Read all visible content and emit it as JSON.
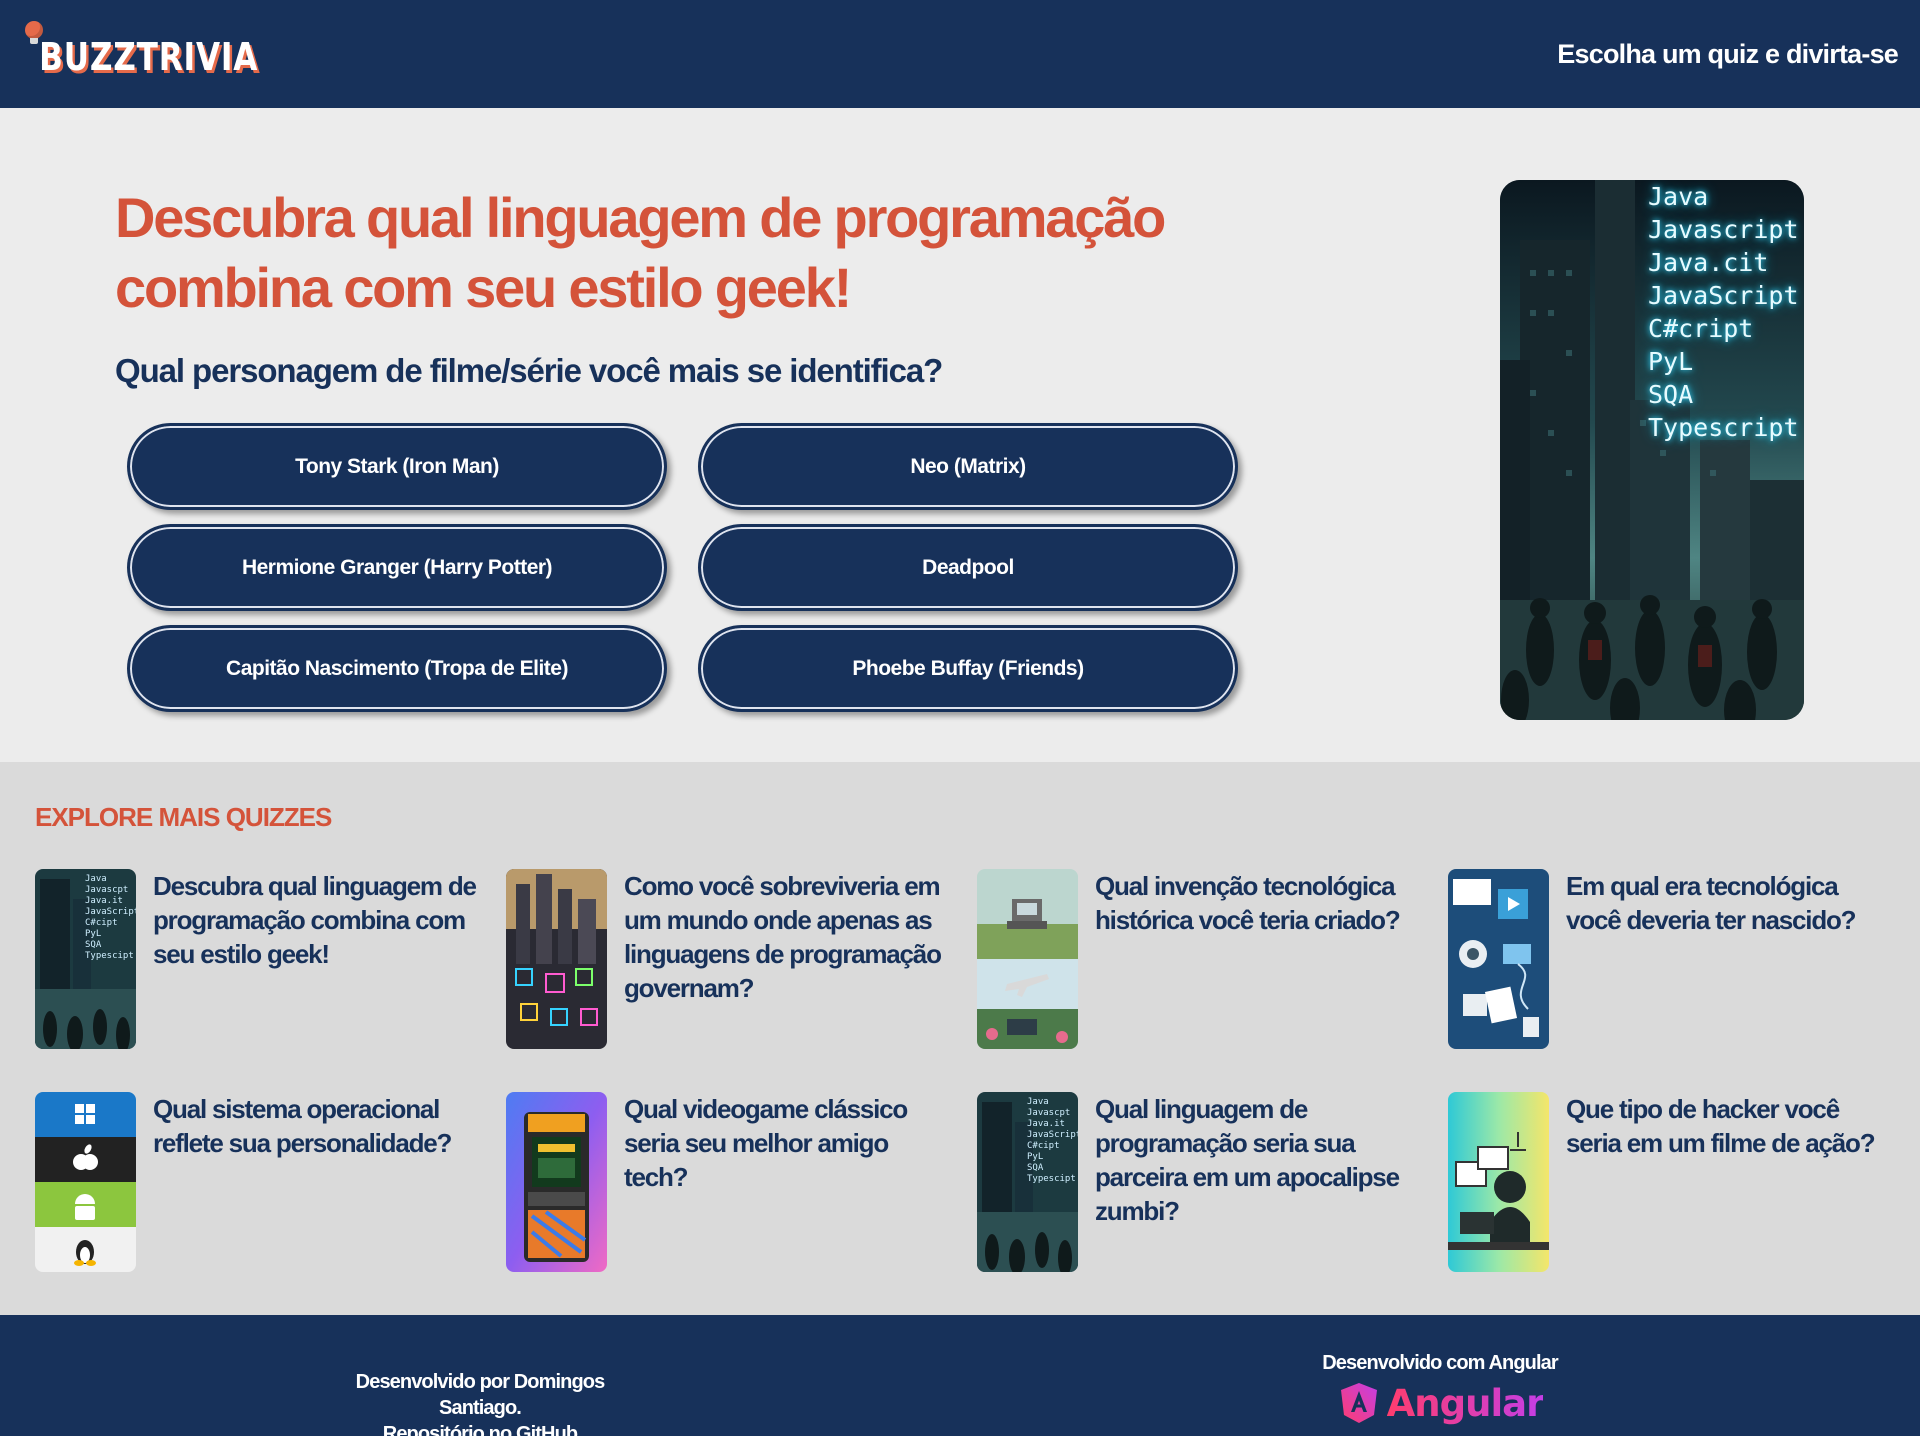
{
  "header": {
    "logo_text": "BUZZTRIVIA",
    "tagline": "Escolha um quiz e divirta-se"
  },
  "hero": {
    "title": "Descubra qual linguagem de programação combina com seu estilo geek!",
    "question": "Qual personagem de filme/série você mais se identifica?",
    "options": [
      "Tony Stark (Iron Man)",
      "Neo (Matrix)",
      "Hermione Granger (Harry Potter)",
      "Deadpool",
      "Capitão Nascimento (Tropa de Elite)",
      "Phoebe Buffay (Friends)"
    ],
    "image_code_lines": [
      "Java",
      "Javascript",
      "Java.cit",
      "JavaScript",
      "C#cript",
      "PyL",
      "SQA",
      "Typescript"
    ]
  },
  "explore": {
    "heading": "EXPLORE MAIS QUIZZES",
    "quizzes": [
      {
        "title": "Descubra qual linguagem de programação combina com seu estilo geek!",
        "thumb": "zombie-city"
      },
      {
        "title": "Como você sobreviveria em um mundo onde apenas as linguagens de programação governam?",
        "thumb": "code-city"
      },
      {
        "title": "Qual invenção tecnológica histórica você teria criado?",
        "thumb": "inventions"
      },
      {
        "title": "Em qual era tecnológica você deveria ter nascido?",
        "thumb": "tech-era"
      },
      {
        "title": "Qual sistema operacional reflete sua personalidade?",
        "thumb": "os-logos"
      },
      {
        "title": "Qual videogame clássico seria seu melhor amigo tech?",
        "thumb": "arcade"
      },
      {
        "title": "Qual linguagem de programação seria sua parceira em um apocalipse zumbi?",
        "thumb": "zombie-city"
      },
      {
        "title": "Que tipo de hacker você seria em um filme de ação?",
        "thumb": "hacker"
      }
    ]
  },
  "footer": {
    "dev_line": "Desenvolvido por Domingos Santiago.",
    "repo_prefix": "Repositório no ",
    "repo_link": "GitHub",
    "built_with": "Desenvolvido com Angular",
    "angular_word": "Angular"
  },
  "colors": {
    "navy": "#17315a",
    "accent": "#d4533a",
    "page_bg": "#ececec",
    "explore_bg": "#dadada"
  }
}
